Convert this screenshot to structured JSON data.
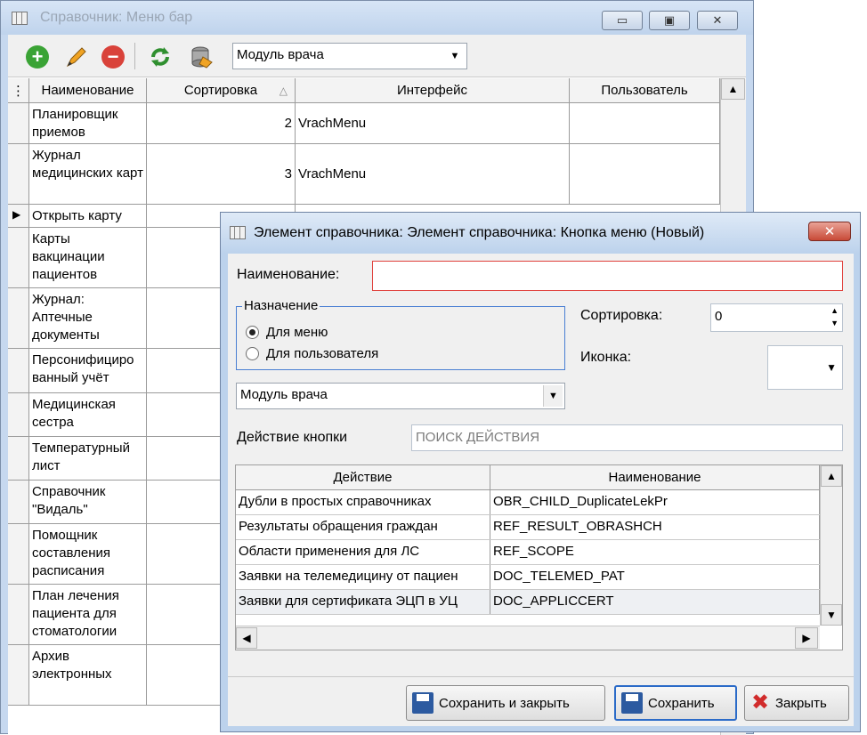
{
  "main_window": {
    "title": "Справочник: Меню бар",
    "controls": {
      "minimize": "▭",
      "maximize": "▣",
      "close": "✕"
    },
    "toolbar": {
      "module_combo_value": "Модуль врача",
      "icons": [
        "add-icon",
        "edit-pencil-icon",
        "delete-icon",
        "refresh-icon",
        "database-icon"
      ]
    },
    "grid": {
      "columns": [
        "Наименование",
        "Сортировка",
        "Интерфейс",
        "Пользователь"
      ],
      "sort_indicator": "△",
      "rows": [
        {
          "name": "Планировщик приемов",
          "sort": "2",
          "interface": "VrachMenu",
          "user": ""
        },
        {
          "name": "Журнал медицинских карт",
          "sort": "3",
          "interface": "VrachMenu",
          "user": ""
        },
        {
          "name": "Открыть карту",
          "sort": "",
          "interface": "",
          "user": "",
          "current": true
        },
        {
          "name": "Карты вакцинации пациентов",
          "sort": "",
          "interface": "",
          "user": ""
        },
        {
          "name": "Журнал: Аптечные документы",
          "sort": "",
          "interface": "",
          "user": ""
        },
        {
          "name": "Персонифициро ванный учёт",
          "sort": "",
          "interface": "",
          "user": ""
        },
        {
          "name": "Медицинская сестра",
          "sort": "",
          "interface": "",
          "user": ""
        },
        {
          "name": "Температурный лист",
          "sort": "",
          "interface": "",
          "user": ""
        },
        {
          "name": "Справочник \"Видаль\"",
          "sort": "",
          "interface": "",
          "user": ""
        },
        {
          "name": "Помощник составления расписания",
          "sort": "",
          "interface": "",
          "user": ""
        },
        {
          "name": "План лечения пациента для стоматологии",
          "sort": "",
          "interface": "",
          "user": ""
        },
        {
          "name": "Архив электронных",
          "sort": "",
          "interface": "",
          "user": ""
        }
      ]
    }
  },
  "dialog": {
    "title": "Элемент справочника: Элемент справочника: Кнопка меню (Новый)",
    "close_glyph": "✕",
    "name_label": "Наименование:",
    "name_value": "",
    "purpose_group": {
      "legend": "Назначение",
      "options": [
        "Для меню",
        "Для пользователя"
      ],
      "selected": "Для меню"
    },
    "sort_label": "Сортировка:",
    "sort_value": "0",
    "icon_label": "Иконка:",
    "module_value": "Модуль врача",
    "action_label": "Действие кнопки",
    "action_placeholder": "ПОИСК ДЕЙСТВИЯ",
    "actions_grid": {
      "columns": [
        "Действие",
        "Наименование"
      ],
      "rows": [
        {
          "action": "Дубли в простых справочниках",
          "name": "OBR_CHILD_DuplicateLekPr"
        },
        {
          "action": "Результаты обращения граждан",
          "name": "REF_RESULT_OBRASHCH"
        },
        {
          "action": "Области применения для ЛС",
          "name": "REF_SCOPE"
        },
        {
          "action": "Заявки на телемедицину от пациен",
          "name": "DOC_TELEMED_PAT"
        },
        {
          "action": "Заявки для сертификата ЭЦП в УЦ",
          "name": "DOC_APPLICCERT"
        }
      ]
    },
    "buttons": {
      "save_close": "Сохранить и закрыть",
      "save": "Сохранить",
      "close": "Закрыть"
    }
  },
  "colors": {
    "title_bar": "#bcd2ec",
    "required_border": "#e0413c",
    "focus_border": "#2b6bc8"
  }
}
